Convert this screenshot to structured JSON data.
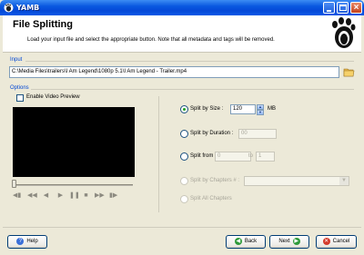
{
  "window": {
    "title": "YAMB",
    "app_icon": "gnome-foot-icon"
  },
  "header": {
    "title": "File Splitting",
    "subtitle": "Load your input file and select the appropriate button. Note that all metadata and tags will be removed.",
    "logo_icon": "gnome-foot-icon"
  },
  "input": {
    "section_label": "Input",
    "path_value": "C:\\Media Files\\trailers\\I Am Legend\\1080p 5.1\\I Am Legend - Trailer.mp4",
    "browse_icon": "folder-icon"
  },
  "options": {
    "section_label": "Options",
    "enable_preview_label": "Enable Video Preview",
    "enable_preview_checked": false,
    "player_controls": [
      "previous-icon",
      "step-back-icon",
      "rewind-icon",
      "play-icon",
      "pause-icon",
      "stop-icon",
      "step-forward-icon",
      "next-icon"
    ],
    "split_by_size": {
      "label": "Split by Size :",
      "value": "120",
      "unit": "MB",
      "selected": true
    },
    "split_by_duration": {
      "label": "Split by Duration :",
      "value": "00",
      "selected": false
    },
    "split_from": {
      "label": "Split from",
      "from_value": "0",
      "to_label": "to",
      "to_value": "1",
      "selected": false
    },
    "split_by_chapters": {
      "label": "Split by Chapters # :",
      "selected_value": "",
      "disabled": true
    },
    "split_all_chapters": {
      "label": "Split All Chapters",
      "disabled": true
    }
  },
  "buttons": {
    "help": "Help",
    "back": "Back",
    "next": "Next",
    "cancel": "Cancel"
  },
  "colors": {
    "section_label": "#0046d5",
    "title_bar": "#0a58e0",
    "radio_dot": "#21a121"
  }
}
